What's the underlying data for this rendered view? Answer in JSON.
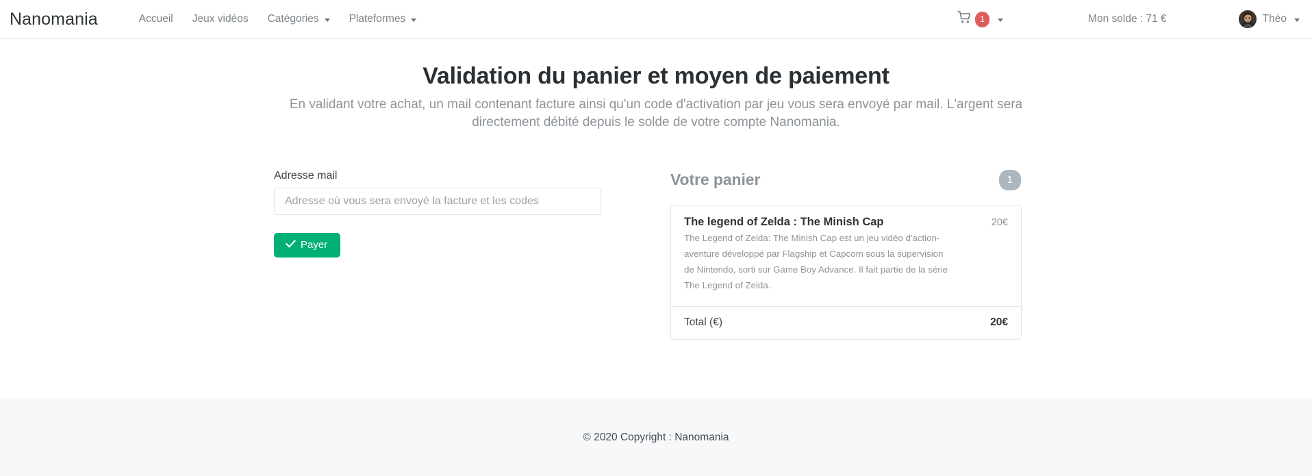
{
  "navbar": {
    "brand": "Nanomania",
    "links": [
      {
        "label": "Accueil",
        "has_caret": false
      },
      {
        "label": "Jeux vidéos",
        "has_caret": false
      },
      {
        "label": "Catégories",
        "has_caret": true
      },
      {
        "label": "Plateformes",
        "has_caret": true
      }
    ],
    "cart": {
      "icon": "shopping-cart-icon",
      "badge": "1"
    },
    "balance": "Mon solde : 71 €",
    "user": {
      "name": "Théo",
      "avatar": "user-avatar-photo"
    }
  },
  "hero": {
    "title": "Validation du panier et moyen de paiement",
    "subtitle": "En validant votre achat, un mail contenant facture ainsi qu'un code d'activation par jeu vous sera envoyé par mail. L'argent sera directement débité depuis le solde de votre compte Nanomania."
  },
  "form": {
    "email_label": "Adresse mail",
    "email_value": "",
    "email_placeholder": "Adresse où vous sera envoyé la facture et les codes",
    "pay_button": "Payer",
    "pay_icon": "check-icon"
  },
  "cart_panel": {
    "title": "Votre panier",
    "count": "1",
    "items": [
      {
        "name": "The legend of Zelda : The Minish Cap",
        "price": "20€",
        "description": "The Legend of Zelda: The Minish Cap est un jeu vidéo d'action-aventure développé par Flagship et Capcom sous la supervision de Nintendo, sorti sur Game Boy Advance. Il fait partie de la série The Legend of Zelda."
      }
    ],
    "total_label": "Total (€)",
    "total_value": "20€"
  },
  "footer": {
    "copyright": "© 2020 Copyright : Nanomania"
  },
  "colors": {
    "accent_green": "#00b074",
    "badge_red": "#e05c5c",
    "badge_gray": "#adb5bd",
    "muted_text": "#8d949a",
    "title_dark": "#2b3034",
    "footer_bg": "#f6f8fa"
  }
}
